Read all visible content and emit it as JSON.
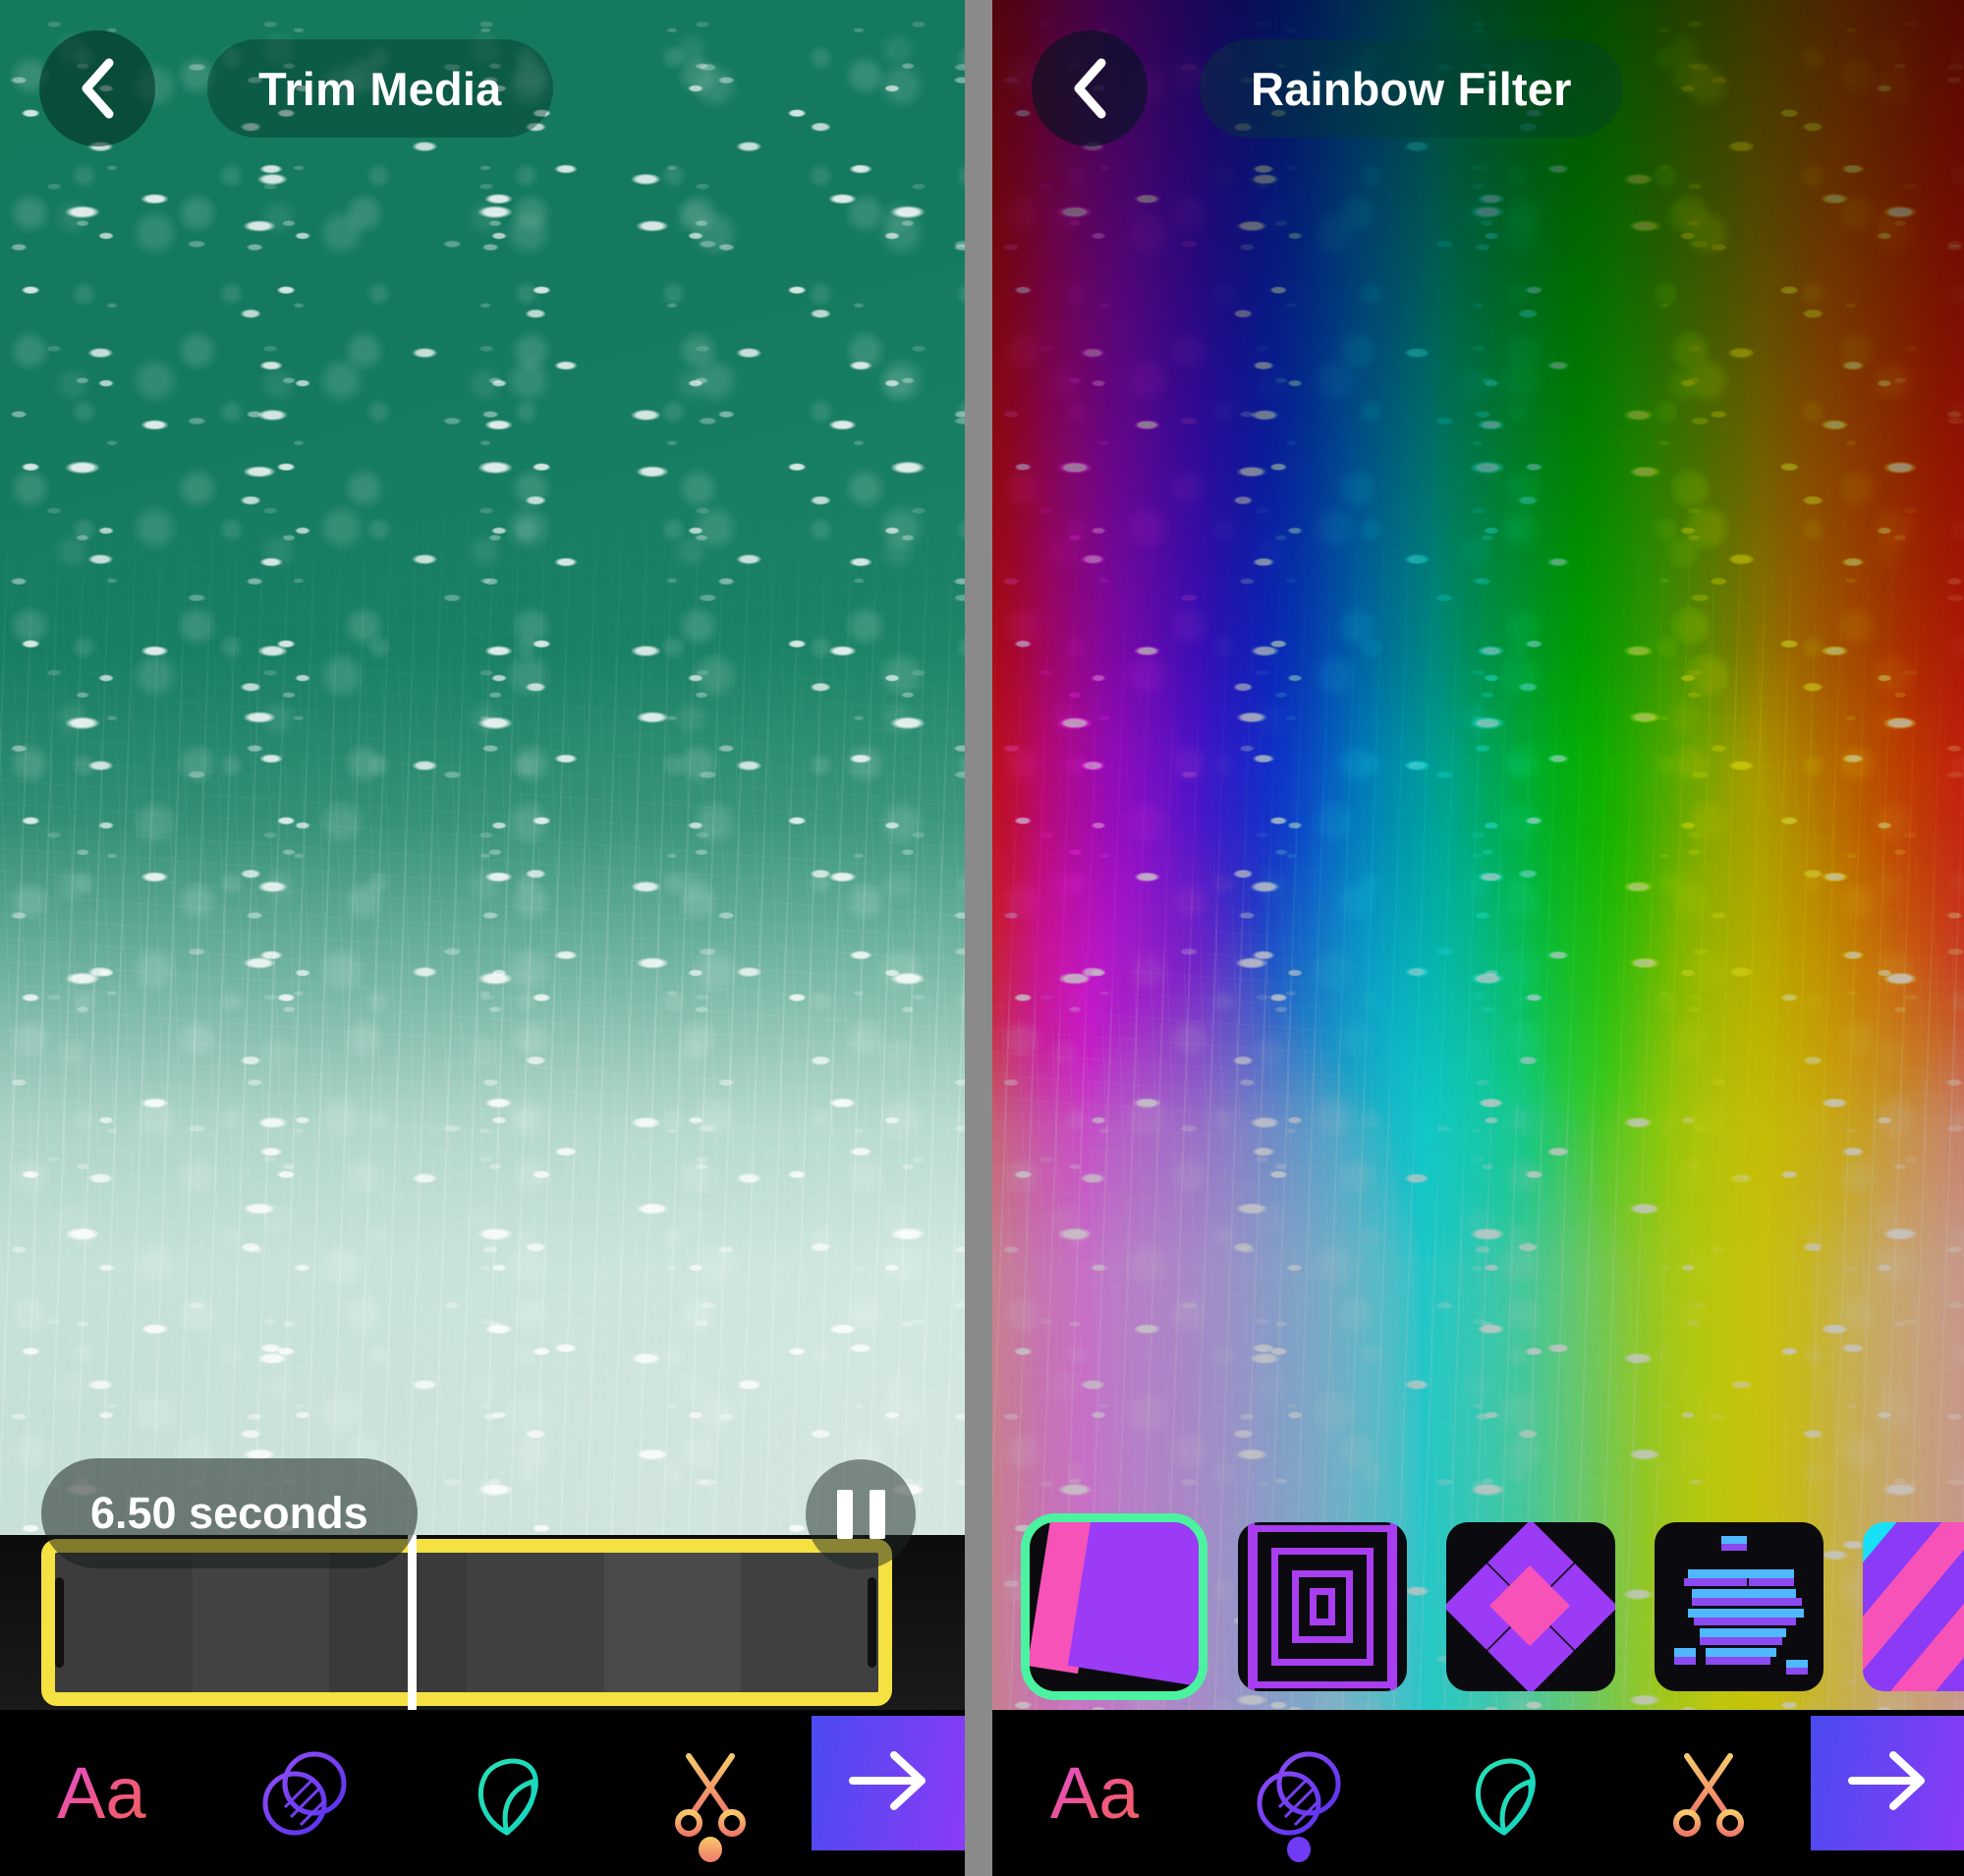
{
  "panels": [
    {
      "id": "trim",
      "header": {
        "back_icon": "chevron-left-icon",
        "title": "Trim Media"
      },
      "duration_label": "6.50 seconds",
      "playback": {
        "state_icon": "pause-icon"
      },
      "trim": {
        "frame_color": "#f5e142",
        "handle_color": "#111111",
        "playhead_color": "#ffffff",
        "thumbnail_count": 6
      },
      "toolbar": {
        "items": [
          {
            "name": "text-tool",
            "icon": "text-aa-icon",
            "label": "Aa",
            "color": "#ee5a86",
            "active": false
          },
          {
            "name": "filters-tool",
            "icon": "overlap-circles-icon",
            "label": "",
            "color": "#6f3bf5",
            "active": false
          },
          {
            "name": "effects-tool",
            "icon": "teardrop-icon",
            "label": "",
            "color": "#1fd9ac",
            "active": false
          },
          {
            "name": "trim-tool",
            "icon": "scissors-icon",
            "label": "",
            "color": "#f0a75e",
            "active": true
          }
        ],
        "next_button": {
          "name": "next-button",
          "icon": "arrow-right-icon"
        }
      }
    },
    {
      "id": "filter",
      "header": {
        "back_icon": "chevron-left-icon",
        "title": "Rainbow Filter"
      },
      "filters": [
        {
          "name": "filter-shapes",
          "selected": true
        },
        {
          "name": "filter-tunnel",
          "selected": false
        },
        {
          "name": "filter-diamonds",
          "selected": false
        },
        {
          "name": "filter-glitch",
          "selected": false
        },
        {
          "name": "filter-stripes",
          "selected": false
        }
      ],
      "selection_color": "#4bf3a0",
      "toolbar": {
        "items": [
          {
            "name": "text-tool",
            "icon": "text-aa-icon",
            "label": "Aa",
            "color": "#ee5a86",
            "active": false
          },
          {
            "name": "filters-tool",
            "icon": "overlap-circles-icon",
            "label": "",
            "color": "#6f3bf5",
            "active": true
          },
          {
            "name": "effects-tool",
            "icon": "teardrop-icon",
            "label": "",
            "color": "#1fd9ac",
            "active": false
          },
          {
            "name": "trim-tool",
            "icon": "scissors-icon",
            "label": "",
            "color": "#f0a75e",
            "active": false
          }
        ],
        "next_button": {
          "name": "next-button",
          "icon": "arrow-right-icon"
        }
      }
    }
  ],
  "colors": {
    "ocean_green": "#15795e",
    "trim_yellow": "#f5e142",
    "next_gradient_start": "#4b4bf0",
    "next_gradient_end": "#8b3bf5",
    "divider_gray": "#8a8a8a"
  }
}
